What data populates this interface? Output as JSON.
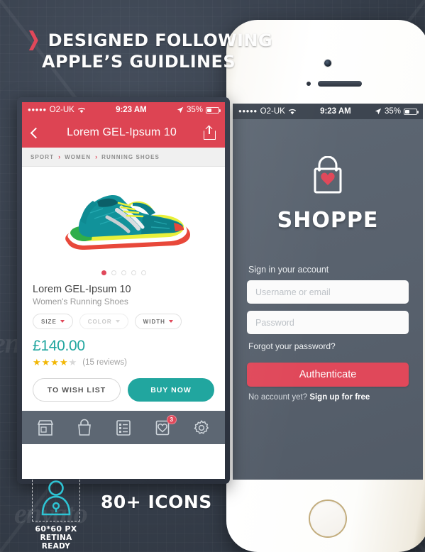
{
  "headline": {
    "arrow_icon": "chevron-right-icon",
    "line1": "DESIGNED FOLLOWING",
    "line2": "APPLE’S GUIDLINES"
  },
  "watermarks": [
    "envato",
    "envato",
    "envato",
    "envato",
    "envato",
    "envato"
  ],
  "status_bar": {
    "signal_dots": "●●●●●",
    "carrier": "O2-UK",
    "wifi_icon": "wifi-icon",
    "time": "9:23 AM",
    "location_icon": "location-arrow-icon",
    "battery_percent": "35%",
    "battery_icon": "battery-icon"
  },
  "product_screen": {
    "nav": {
      "back_icon": "chevron-left-icon",
      "title": "Lorem GEL-Ipsum 10",
      "share_icon": "share-icon"
    },
    "breadcrumb": {
      "items": [
        "SPORT",
        "WOMEN",
        "RUNNING SHOES"
      ],
      "separator": "›"
    },
    "gallery": {
      "image_alt": "teal-running-shoe",
      "dot_count": 5,
      "active_dot": 1
    },
    "title": "Lorem GEL-Ipsum 10",
    "subtitle": "Women's Running Shoes",
    "options": [
      {
        "label": "SIZE",
        "icon": "chevron-down-icon",
        "dim": false
      },
      {
        "label": "COLOR",
        "icon": "chevron-down-icon",
        "dim": true
      },
      {
        "label": "WIDTH",
        "icon": "chevron-down-icon",
        "dim": false
      }
    ],
    "price": "£140.00",
    "rating": {
      "filled": 4,
      "total": 5,
      "reviews_text": "(15 reviews)"
    },
    "buttons": {
      "wishlist": "TO WISH LIST",
      "buy": "BUY NOW"
    },
    "tab_bar": [
      {
        "name": "store-icon",
        "badge": null
      },
      {
        "name": "shopping-bag-icon",
        "badge": null
      },
      {
        "name": "list-icon",
        "badge": null
      },
      {
        "name": "wishlist-heart-icon",
        "badge": "3"
      },
      {
        "name": "gear-icon",
        "badge": null
      }
    ]
  },
  "login_screen": {
    "logo_icon": "shopping-bag-heart-icon",
    "brand": "SHOPPE",
    "sign_in_label": "Sign in your account",
    "username_placeholder": "Username or email",
    "password_placeholder": "Password",
    "forgot_text": "Forgot your password?",
    "authenticate_button": "Authenticate",
    "no_account_text": "No account yet?",
    "sign_up_link": "Sign up for free"
  },
  "icons_footer": {
    "preview_icon": "user-lock-icon",
    "size_caption": "60*60 PX",
    "retina_caption": "RETINA READY",
    "count_label": "80+ ICONS"
  },
  "colors": {
    "red": "#dd4453",
    "accent_red": "#e0485a",
    "teal": "#21a69f",
    "slate": "#5d6773",
    "background": "#3b4350",
    "cyan_icon": "#2ec4d4"
  }
}
